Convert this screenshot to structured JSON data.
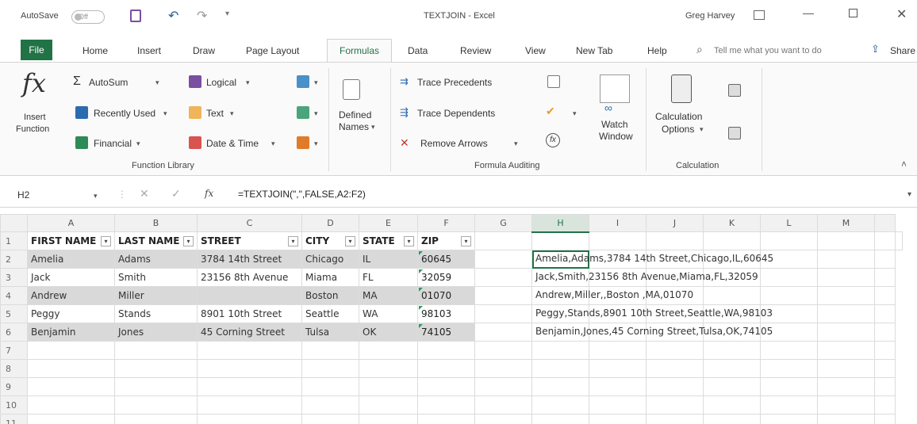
{
  "titlebar": {
    "autosave": "AutoSave",
    "toggle": "Off",
    "doc_title": "TEXTJOIN - Excel",
    "user": "Greg Harvey"
  },
  "tabs": [
    "File",
    "Home",
    "Insert",
    "Draw",
    "Page Layout",
    "Formulas",
    "Data",
    "Review",
    "View",
    "New Tab",
    "Help"
  ],
  "tell_me": "Tell me what you want to do",
  "share": "Share",
  "ribbon": {
    "insert_function": [
      "Insert",
      "Function"
    ],
    "autosum": "AutoSum",
    "recently_used": "Recently Used",
    "financial": "Financial",
    "logical": "Logical",
    "text": "Text",
    "date_time": "Date & Time",
    "function_library": "Function Library",
    "defined_names": [
      "Defined",
      "Names"
    ],
    "trace_precedents": "Trace Precedents",
    "trace_dependents": "Trace Dependents",
    "remove_arrows": "Remove Arrows",
    "watch_window": [
      "Watch",
      "Window"
    ],
    "formula_auditing": "Formula Auditing",
    "calc_options": [
      "Calculation",
      "Options"
    ],
    "calculation": "Calculation"
  },
  "formula_bar": {
    "name_box": "H2",
    "fx": "fx",
    "formula": "=TEXTJOIN(\",\",FALSE,A2:F2)"
  },
  "sheet": {
    "columns": [
      "A",
      "B",
      "C",
      "D",
      "E",
      "F",
      "G",
      "H",
      "I",
      "J",
      "K",
      "L",
      "M",
      ""
    ],
    "header": [
      "FIRST NAME",
      "LAST NAME",
      "STREET",
      "CITY",
      "STATE",
      "ZIP"
    ],
    "rows": [
      {
        "n": "2",
        "cells": [
          "Amelia",
          "Adams",
          "3784 14th Street",
          "Chicago",
          "IL",
          "60645"
        ],
        "joined": "Amelia,Adams,3784 14th Street,Chicago,IL,60645"
      },
      {
        "n": "3",
        "cells": [
          "Jack",
          "Smith",
          "23156 8th Avenue",
          "Miama",
          "FL",
          "32059"
        ],
        "joined": "Jack,Smith,23156 8th Avenue,Miama,FL,32059"
      },
      {
        "n": "4",
        "cells": [
          "Andrew",
          "Miller",
          "",
          "Boston",
          "MA",
          "01070"
        ],
        "joined": "Andrew,Miller,,Boston ,MA,01070"
      },
      {
        "n": "5",
        "cells": [
          "Peggy",
          "Stands",
          "8901 10th Street",
          "Seattle",
          "WA",
          "98103"
        ],
        "joined": "Peggy,Stands,8901 10th Street,Seattle,WA,98103"
      },
      {
        "n": "6",
        "cells": [
          "Benjamin",
          "Jones",
          "45 Corning Street",
          "Tulsa",
          "OK",
          "74105"
        ],
        "joined": "Benjamin,Jones,45 Corning Street,Tulsa,OK,74105"
      }
    ],
    "empty_rows": [
      "7",
      "8",
      "9",
      "10",
      "11"
    ],
    "row1": "1"
  },
  "colors": {
    "accent": "#217346",
    "band": "#d9d9d9"
  }
}
